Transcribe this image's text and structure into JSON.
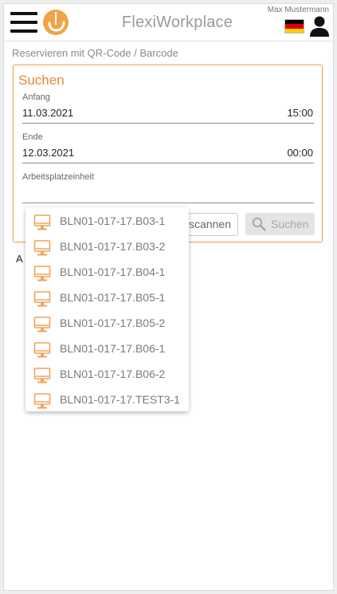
{
  "header": {
    "app_title": "FlexiWorkplace",
    "user_name": "Max Mustermann",
    "menu_icon": "hamburger-menu-icon",
    "logo_icon": "flexi-logo-icon",
    "flag_icon": "german-flag-icon",
    "user_icon": "user-icon"
  },
  "breadcrumb": "Reservieren mit QR-Code / Barcode",
  "search_panel": {
    "title": "Suchen",
    "start": {
      "label": "Anfang",
      "date": "11.03.2021",
      "time": "15:00"
    },
    "end": {
      "label": "Ende",
      "date": "12.03.2021",
      "time": "00:00"
    },
    "unit": {
      "label": "Arbeitsplatzeinheit",
      "value": ""
    },
    "scan_button_label": "nscannen",
    "search_button_label": "Suchen",
    "search_icon": "search-icon"
  },
  "result_fragment": "A",
  "dropdown": {
    "item_icon": "desktop-monitor-icon",
    "items": [
      "BLN01-017-17.B03-1",
      "BLN01-017-17.B03-2",
      "BLN01-017-17.B04-1",
      "BLN01-017-17.B05-1",
      "BLN01-017-17.B05-2",
      "BLN01-017-17.B06-1",
      "BLN01-017-17.B06-2",
      "BLN01-017-17.TEST3-1"
    ]
  },
  "colors": {
    "accent": "#e8873a",
    "panel_border": "#f0a35a",
    "muted_text": "#8a8a8a",
    "flag_black": "#000000",
    "flag_red": "#dd0000",
    "flag_gold": "#ffce00"
  }
}
